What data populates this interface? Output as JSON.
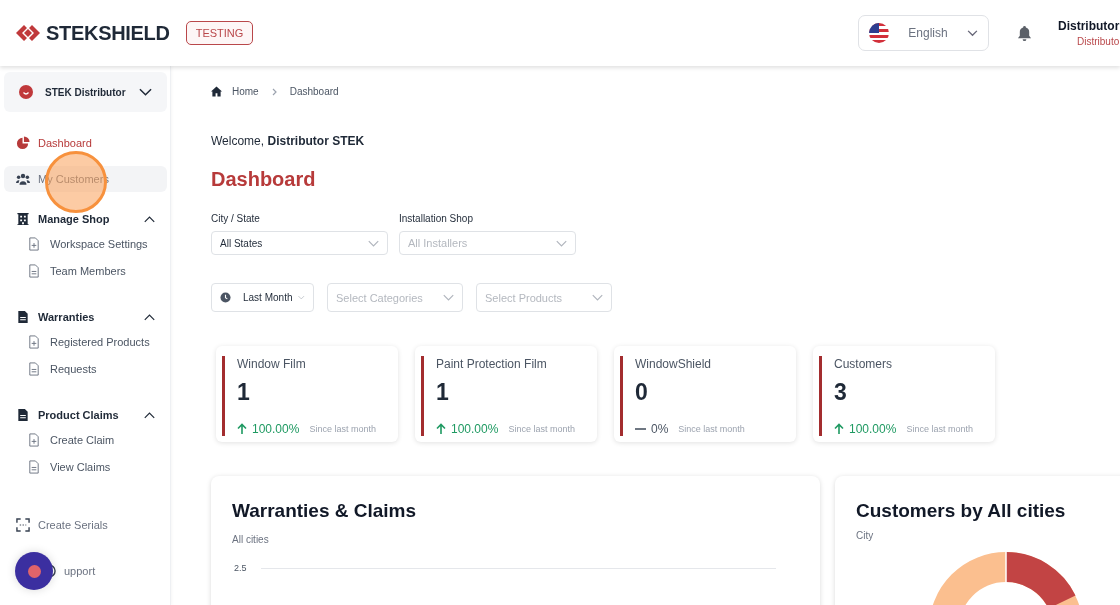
{
  "header": {
    "logo": "STEKSHIELD",
    "env_badge": "TESTING",
    "language": "English",
    "user_name": "Distributor",
    "user_role": "Distributo"
  },
  "sidebar": {
    "account": "STEK Distributor",
    "items": [
      {
        "kind": "link",
        "label": "Dashboard",
        "selected": true,
        "hovered": false
      },
      {
        "kind": "link",
        "label": "My Customers",
        "selected": false,
        "hovered": true
      },
      {
        "kind": "group",
        "label": "Manage Shop",
        "expanded": true,
        "children": [
          {
            "label": "Workspace Settings"
          },
          {
            "label": "Team Members"
          }
        ]
      },
      {
        "kind": "group",
        "label": "Warranties",
        "expanded": true,
        "children": [
          {
            "label": "Registered Products"
          },
          {
            "label": "Requests"
          }
        ]
      },
      {
        "kind": "group",
        "label": "Product Claims",
        "expanded": true,
        "children": [
          {
            "label": "Create Claim"
          },
          {
            "label": "View Claims"
          }
        ]
      },
      {
        "kind": "link",
        "label": "Create Serials",
        "selected": false,
        "hovered": false
      },
      {
        "kind": "link",
        "label": "upport",
        "selected": false,
        "hovered": false
      }
    ]
  },
  "breadcrumb": [
    "Home",
    "Dashboard"
  ],
  "welcome": "Welcome, **Distributor STEK**",
  "page_title": "Dashboard",
  "filters": [
    {
      "label": "City / State",
      "value": "All States"
    },
    {
      "label": "Installation Shop",
      "placeholder": "All Installers"
    }
  ],
  "period": {
    "value": "Last Month"
  },
  "selects": [
    {
      "placeholder": "Select Categories"
    },
    {
      "placeholder": "Select Products"
    }
  ],
  "stats": [
    {
      "title": "Window Film",
      "value": "1",
      "kind": "up",
      "change": "100.00%",
      "note": "Since last month"
    },
    {
      "title": "Paint Protection Film",
      "value": "1",
      "kind": "up",
      "change": "100.00%",
      "note": "Since last month"
    },
    {
      "title": "WindowShield",
      "value": "0",
      "kind": "flat",
      "change": "0%",
      "note": "Since last month"
    },
    {
      "title": "Customers",
      "value": "3",
      "kind": "up",
      "change": "100.00%",
      "note": "Since last month"
    }
  ],
  "panels": [
    {
      "title": "Warranties & Claims",
      "subtitle": "All cities",
      "kind": "line",
      "axis_label": "2.5"
    },
    {
      "title": "Customers by All cities",
      "subtitle": "City",
      "kind": "donut"
    }
  ]
}
